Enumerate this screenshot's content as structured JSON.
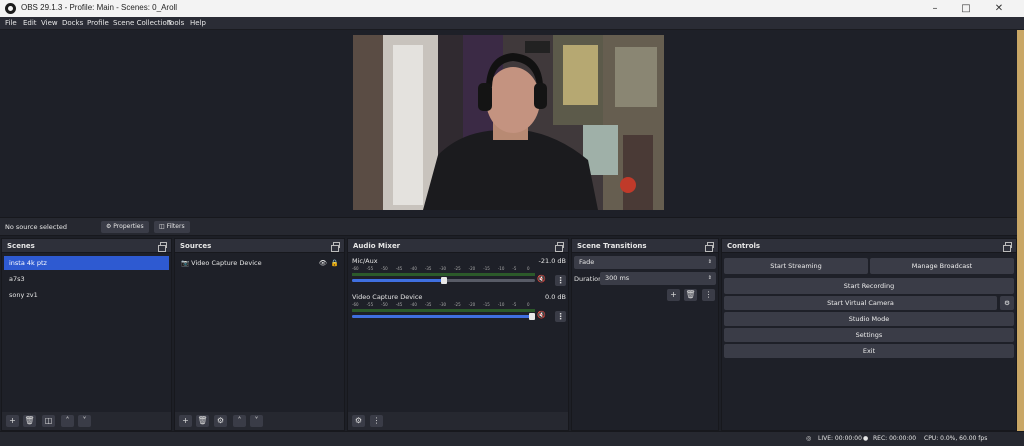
{
  "window": {
    "title": "OBS 29.1.3 - Profile: Main - Scenes: 0_Aroll"
  },
  "menu": [
    "File",
    "Edit",
    "View",
    "Docks",
    "Profile",
    "Scene Collection",
    "Tools",
    "Help"
  ],
  "source_bar": {
    "selected": "No source selected",
    "properties": "Properties",
    "filters": "Filters"
  },
  "scenes": {
    "title": "Scenes",
    "items": [
      "insta 4k ptz",
      "a7s3",
      "sony zv1"
    ],
    "selected_index": 0
  },
  "sources": {
    "title": "Sources",
    "items": [
      "Video Capture Device"
    ]
  },
  "mixer": {
    "title": "Audio Mixer",
    "ticks": [
      "-60",
      "-55",
      "-50",
      "-45",
      "-40",
      "-35",
      "-30",
      "-25",
      "-20",
      "-15",
      "-10",
      "-5",
      "0"
    ],
    "channels": [
      {
        "name": "Mic/Aux",
        "db": "-21.0 dB",
        "level": 0.5,
        "muted": true
      },
      {
        "name": "Video Capture Device",
        "db": "0.0 dB",
        "level": 1.0,
        "muted": true
      }
    ]
  },
  "transitions": {
    "title": "Scene Transitions",
    "selected": "Fade",
    "duration_label": "Duration",
    "duration": "300 ms"
  },
  "controls": {
    "title": "Controls",
    "start_streaming": "Start Streaming",
    "manage_broadcast": "Manage Broadcast",
    "start_recording": "Start Recording",
    "start_virtual_camera": "Start Virtual Camera",
    "studio_mode": "Studio Mode",
    "settings": "Settings",
    "exit": "Exit"
  },
  "status": {
    "live": "LIVE: 00:00:00",
    "rec": "REC: 00:00:00",
    "cpu": "CPU: 0.0%, 60.00 fps"
  },
  "colors": {
    "accent": "#2e5ad1",
    "muted_red": "#d23a3a"
  }
}
